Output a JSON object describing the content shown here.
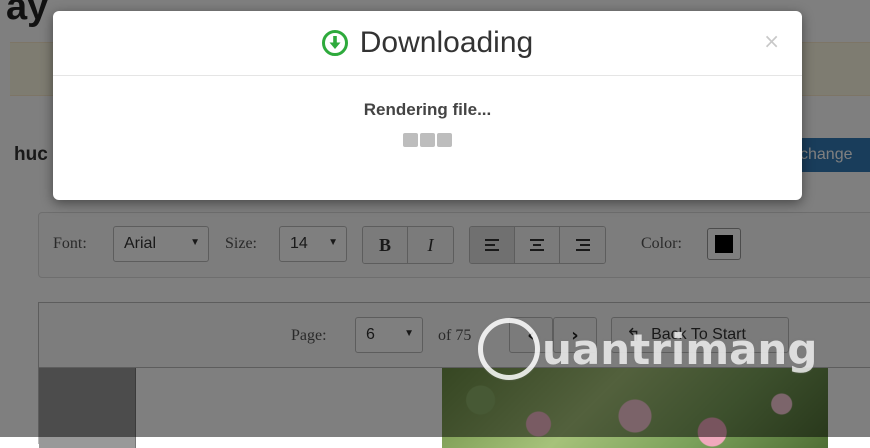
{
  "modal": {
    "title": "Downloading",
    "icon": "download-circle-icon",
    "icon_color": "#2eaa3c",
    "close_label": "×",
    "status": "Rendering file..."
  },
  "background": {
    "heading": "ay",
    "document_name": "huc",
    "change_button": "change",
    "accent": "#337ab7",
    "toolbar": {
      "font_label": "Font:",
      "font_value": "Arial",
      "size_label": "Size:",
      "size_value": "14",
      "bold": "B",
      "italic": "I",
      "align_icons": [
        "align-left-icon",
        "align-center-icon",
        "align-right-icon"
      ],
      "color_label": "Color:",
      "color_value": "#000000"
    },
    "pager": {
      "page_label": "Page:",
      "page_value": "6",
      "of_label": "of 75",
      "back_label": "Back To Start"
    }
  },
  "watermark": {
    "text": "uantrimang"
  }
}
